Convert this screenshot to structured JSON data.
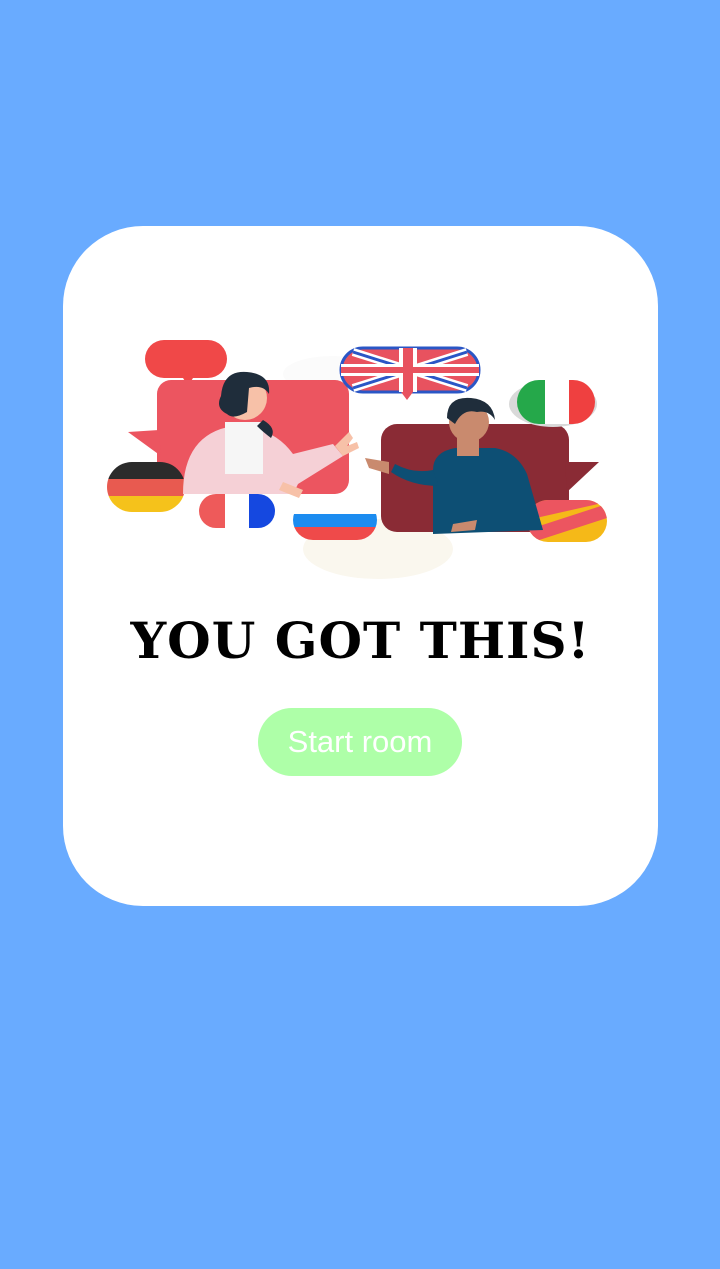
{
  "card": {
    "headline": "YOU GOT THIS!",
    "start_button_label": "Start room"
  },
  "illustration": {
    "subject": "two people talking surrounded by language flag speech bubbles",
    "flags": [
      "uk-flag",
      "italy-flag",
      "germany-flag",
      "france-flag",
      "russia-flag",
      "spain-flag"
    ]
  },
  "colors": {
    "background": "#69abff",
    "card": "#ffffff",
    "button": "#aeffa8",
    "button_text": "#ffffff",
    "headline": "#000000"
  }
}
